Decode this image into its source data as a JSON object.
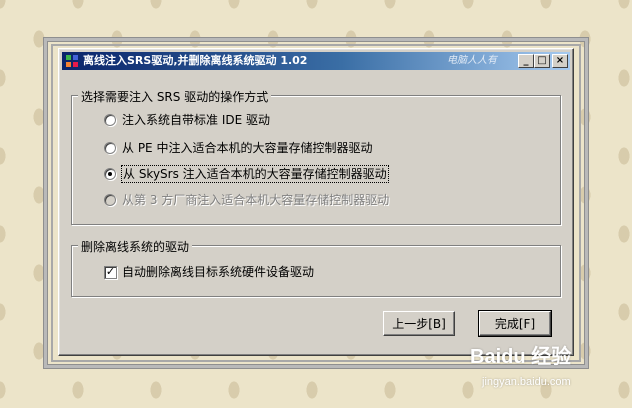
{
  "window": {
    "title": "离线注入SRS驱动,并删除离线系统驱动 1.02",
    "watermark": "电脑人人有",
    "minimize_label": "_",
    "maximize_label": "□",
    "close_label": "×"
  },
  "group_drive": {
    "title": "选择需要注入 SRS 驱动的操作方式",
    "options": [
      {
        "label": "注入系统自带标准 IDE 驱动",
        "checked": false,
        "disabled": false
      },
      {
        "label": "从 PE 中注入适合本机的大容量存储控制器驱动",
        "checked": false,
        "disabled": false
      },
      {
        "label": "从 SkySrs 注入适合本机的大容量存储控制器驱动",
        "checked": true,
        "disabled": false
      },
      {
        "label": "从第 3 方厂商注入适合本机大容量存储控制器驱动",
        "checked": false,
        "disabled": true
      }
    ]
  },
  "group_delete": {
    "title": "删除离线系统的驱动",
    "checkbox_label": "自动删除离线目标系统硬件设备驱动",
    "checkbox_mark": "✓",
    "checked": true
  },
  "buttons": {
    "back_label": "上一步[B]",
    "finish_label": "完成[F]"
  },
  "overlay": {
    "baidu_logo": "Baidu 经验",
    "baidu_url": "jingyan.baidu.com"
  }
}
